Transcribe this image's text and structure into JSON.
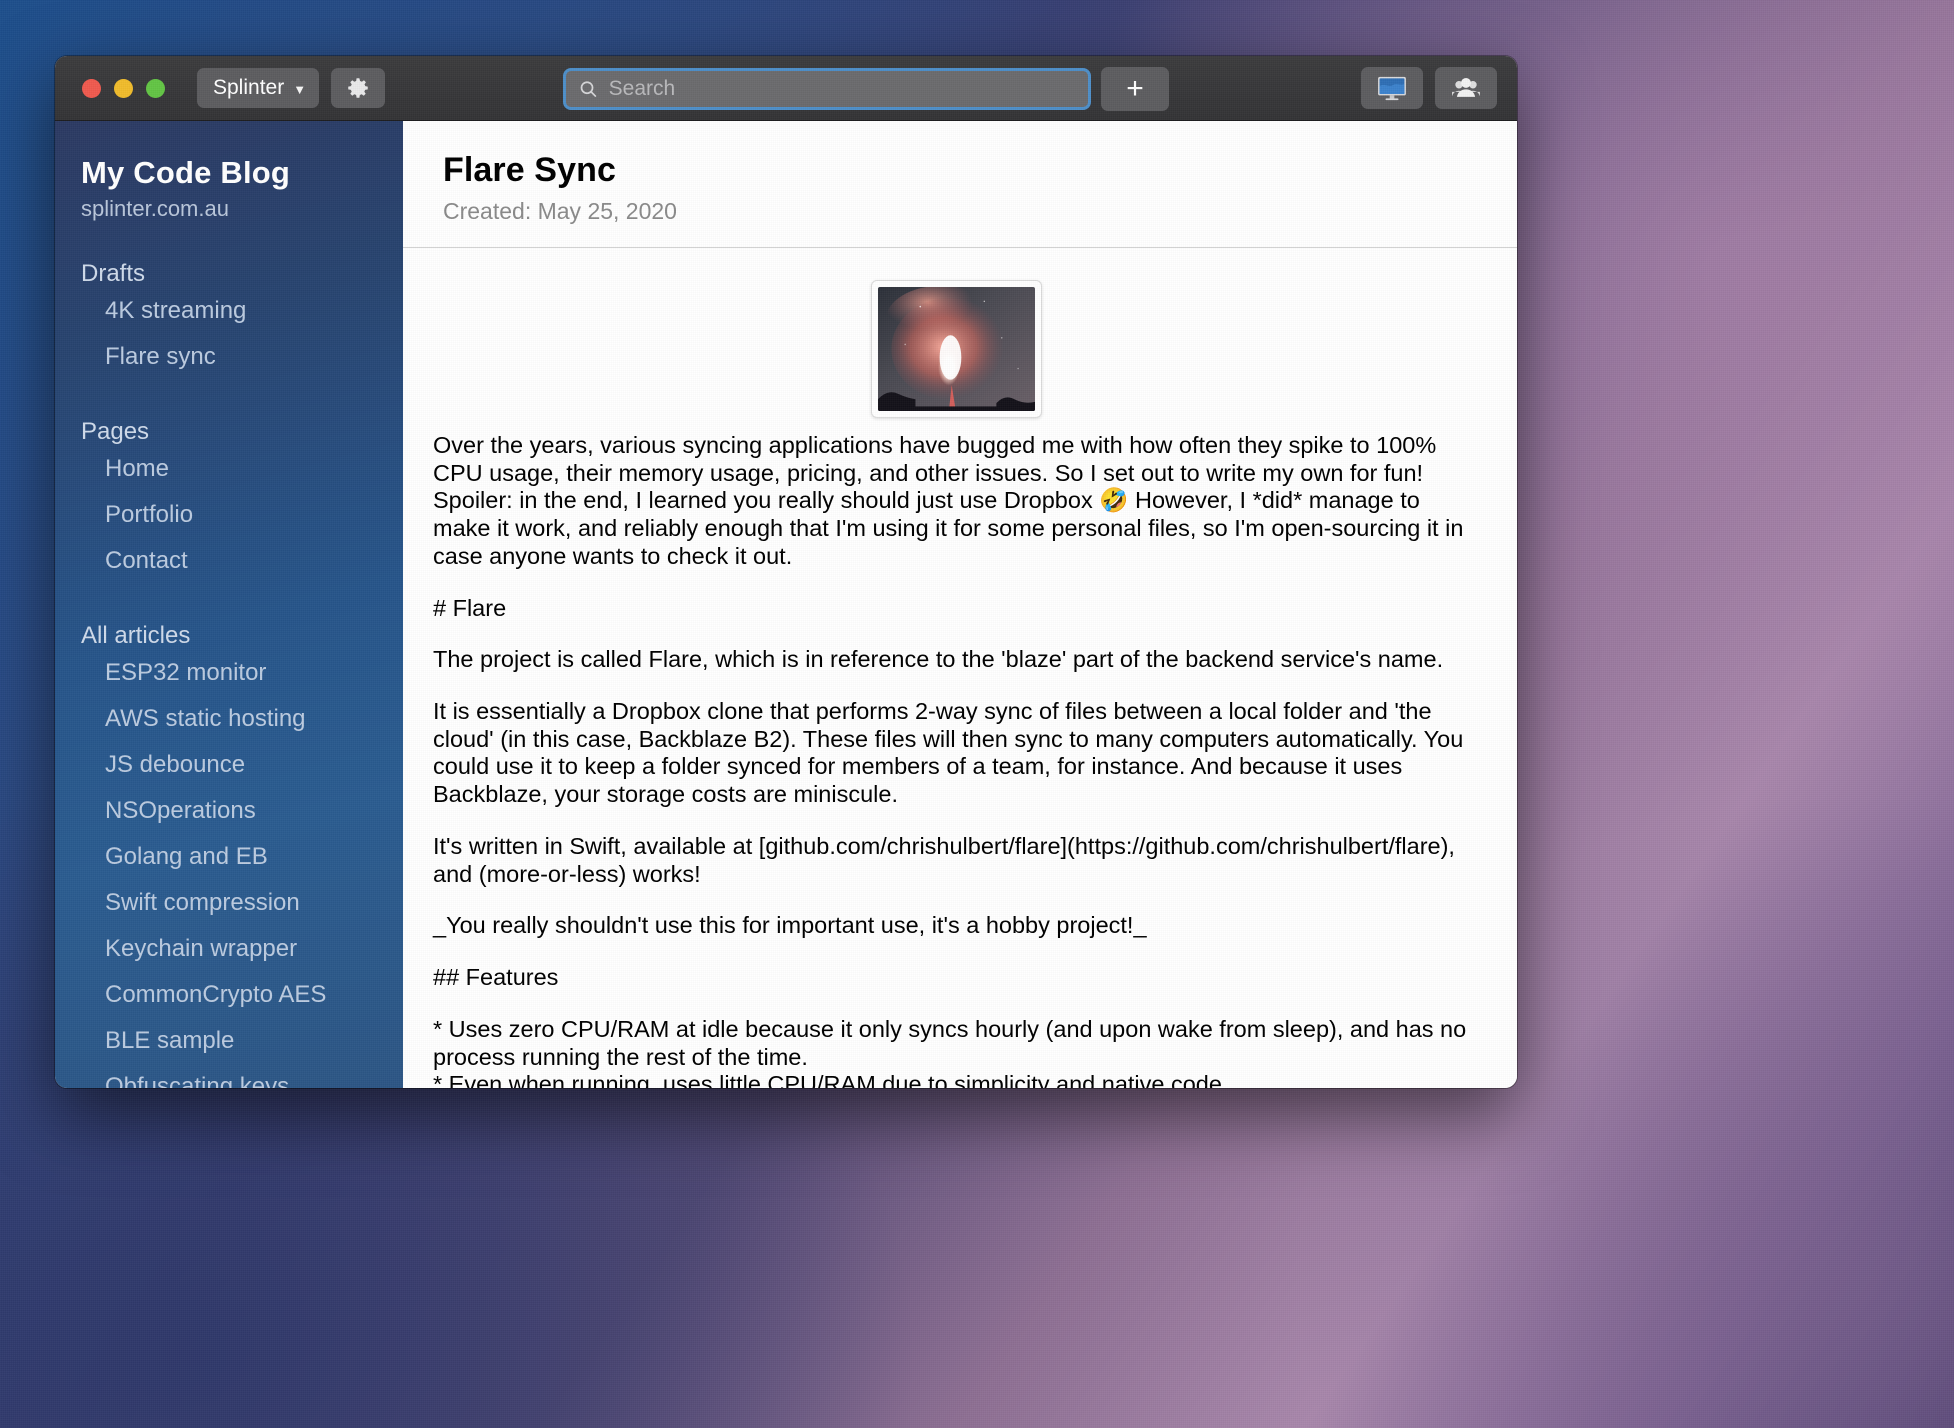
{
  "toolbar": {
    "site_picker_label": "Splinter",
    "site_picker_chevron": "chevron-down-icon",
    "prefs_icon": "gear-icon",
    "search_placeholder": "Search",
    "search_value": "",
    "search_icon": "search-icon",
    "add_label": "+",
    "preview_icon": "display-icon",
    "share_icon": "people-icon"
  },
  "sidebar": {
    "blog_title": "My Code Blog",
    "blog_url": "splinter.com.au",
    "sections": [
      {
        "label": "Drafts",
        "items": [
          "4K streaming",
          "Flare sync"
        ]
      },
      {
        "label": "Pages",
        "items": [
          "Home",
          "Portfolio",
          "Contact"
        ]
      },
      {
        "label": "All articles",
        "items": [
          "ESP32 monitor",
          "AWS static hosting",
          "JS debounce",
          "NSOperations",
          "Golang and EB",
          "Swift compression",
          "Keychain wrapper",
          "CommonCrypto AES",
          "BLE sample",
          "Obfuscating keys"
        ]
      }
    ]
  },
  "article": {
    "title": "Flare Sync",
    "created": "Created: May 25, 2020",
    "thumbnail_alt": "flare-firework-photo",
    "paragraphs": [
      "Over the years, various syncing applications have bugged me with how often they spike to 100% CPU usage, their memory usage, pricing, and other issues. So I set out to write my own for fun! Spoiler: in the end, I learned you really should just use Dropbox 🤣 However, I *did* manage to make it work, and reliably enough that I'm using it for some personal files, so I'm open-sourcing it in case anyone wants to check it out.",
      "# Flare",
      "The project is called Flare, which is in reference to the 'blaze' part of the backend service's name.",
      "It is essentially a Dropbox clone that performs 2-way sync of files between a local folder and 'the cloud' (in this case, Backblaze B2). These files will then sync to many computers automatically. You could use it to keep a folder synced for members of a team, for instance. And because it uses Backblaze, your storage costs are miniscule.",
      "It's written in Swift, available at [github.com/chrishulbert/flare](https://github.com/chrishulbert/flare), and (more-or-less) works!",
      "_You really shouldn't use this for important use, it's a hobby project!_",
      "## Features",
      "* Uses zero CPU/RAM at idle because it only syncs hourly (and upon wake from sleep), and has no process running the rest of the time.\n* Even when running, uses little CPU/RAM due to simplicity and native code."
    ]
  },
  "colors": {
    "accent_blue": "#4e8fc9",
    "sidebar_blue": "#27558a",
    "toolbar_gray": "#3c3c3e",
    "traffic_red": "#f05a4f",
    "traffic_yellow": "#f0bc2c",
    "traffic_green": "#63c545"
  }
}
